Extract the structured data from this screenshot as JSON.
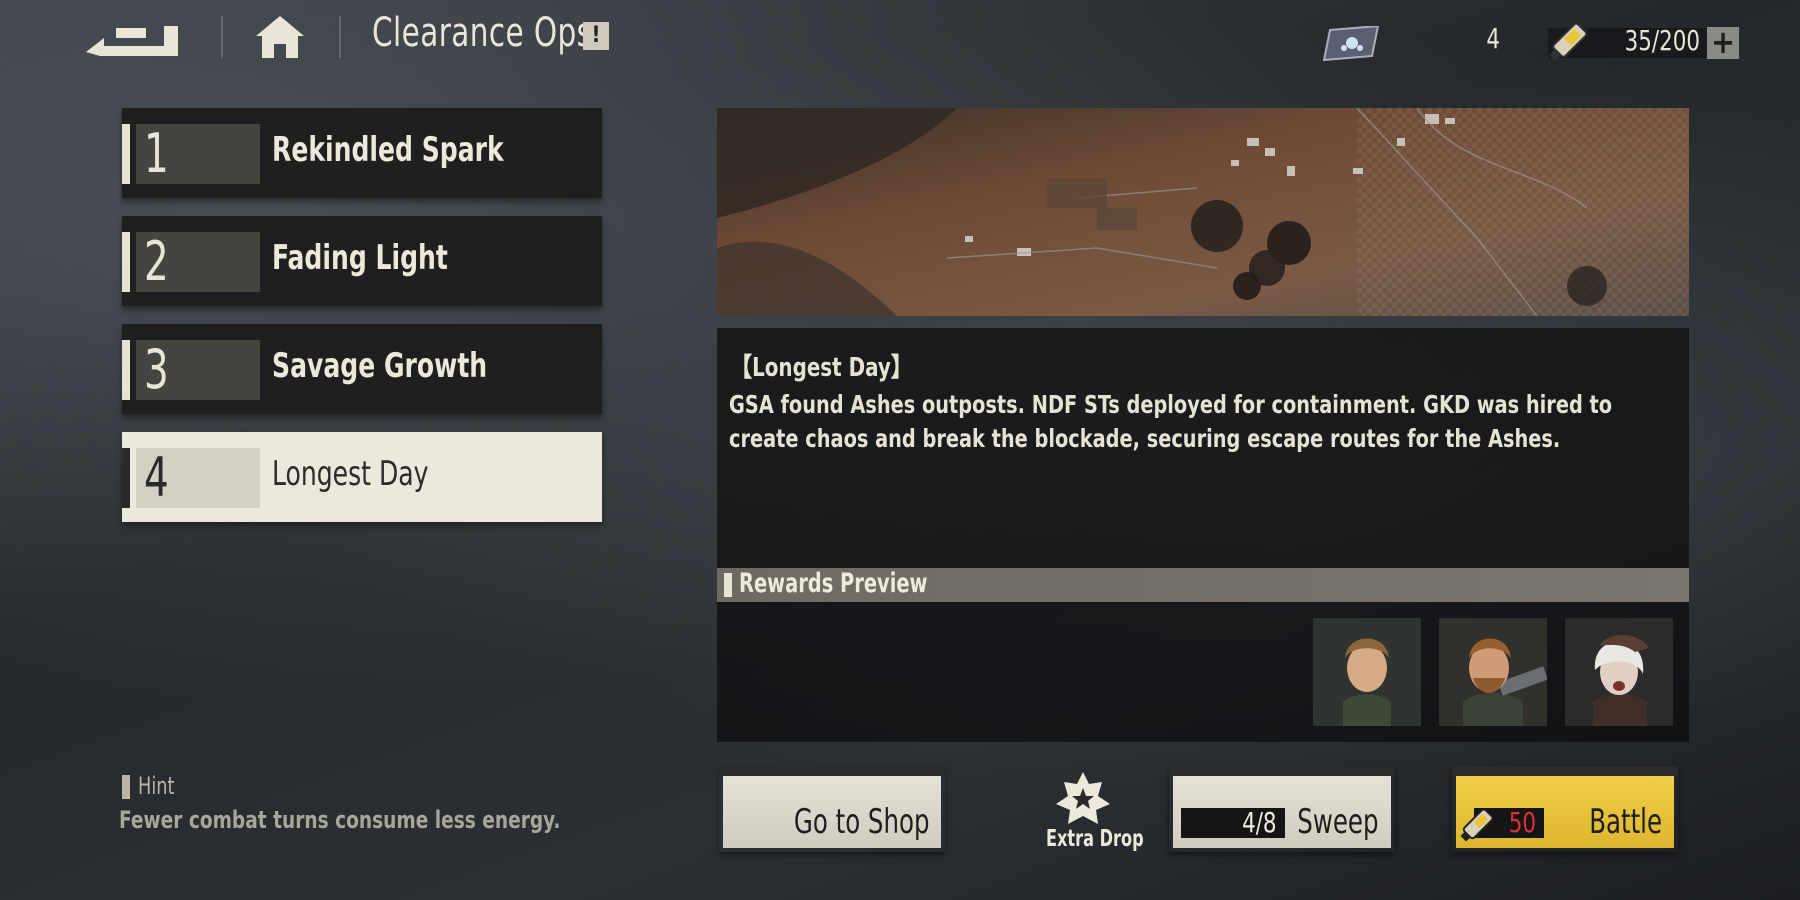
{
  "header": {
    "title": "Clearance Ops",
    "info_badge": "!",
    "resource_count": "4",
    "energy": "35/200",
    "plus": "+",
    "back_icon": "back-arrow-icon",
    "home_icon": "home-icon"
  },
  "stages": [
    {
      "number": "1",
      "name": "Rekindled Spark",
      "selected": false
    },
    {
      "number": "2",
      "name": "Fading Light",
      "selected": false
    },
    {
      "number": "3",
      "name": "Savage Growth",
      "selected": false
    },
    {
      "number": "4",
      "name": "Longest Day",
      "selected": true
    }
  ],
  "hint": {
    "label": "Hint",
    "text": "Fewer combat turns consume less energy."
  },
  "detail": {
    "title": "【Longest Day】",
    "description": "GSA found Ashes outposts. NDF STs deployed for containment. GKD was hired to create chaos and break the blockade, securing escape routes for the Ashes."
  },
  "rewards": {
    "label": "Rewards Preview",
    "items": [
      {
        "icon": "character-portrait-1"
      },
      {
        "icon": "character-portrait-2"
      },
      {
        "icon": "character-portrait-3"
      }
    ]
  },
  "actions": {
    "shop_label": "Go to Shop",
    "extra_drop_label": "Extra Drop",
    "sweep_label": "Sweep",
    "sweep_count": "4/8",
    "battle_label": "Battle",
    "battle_cost": "50"
  },
  "colors": {
    "accent_light": "#e7e3d4",
    "battle_gold": "#e8c23a",
    "cost_red": "#e03030",
    "panel_dark": "#1f1f1f"
  }
}
